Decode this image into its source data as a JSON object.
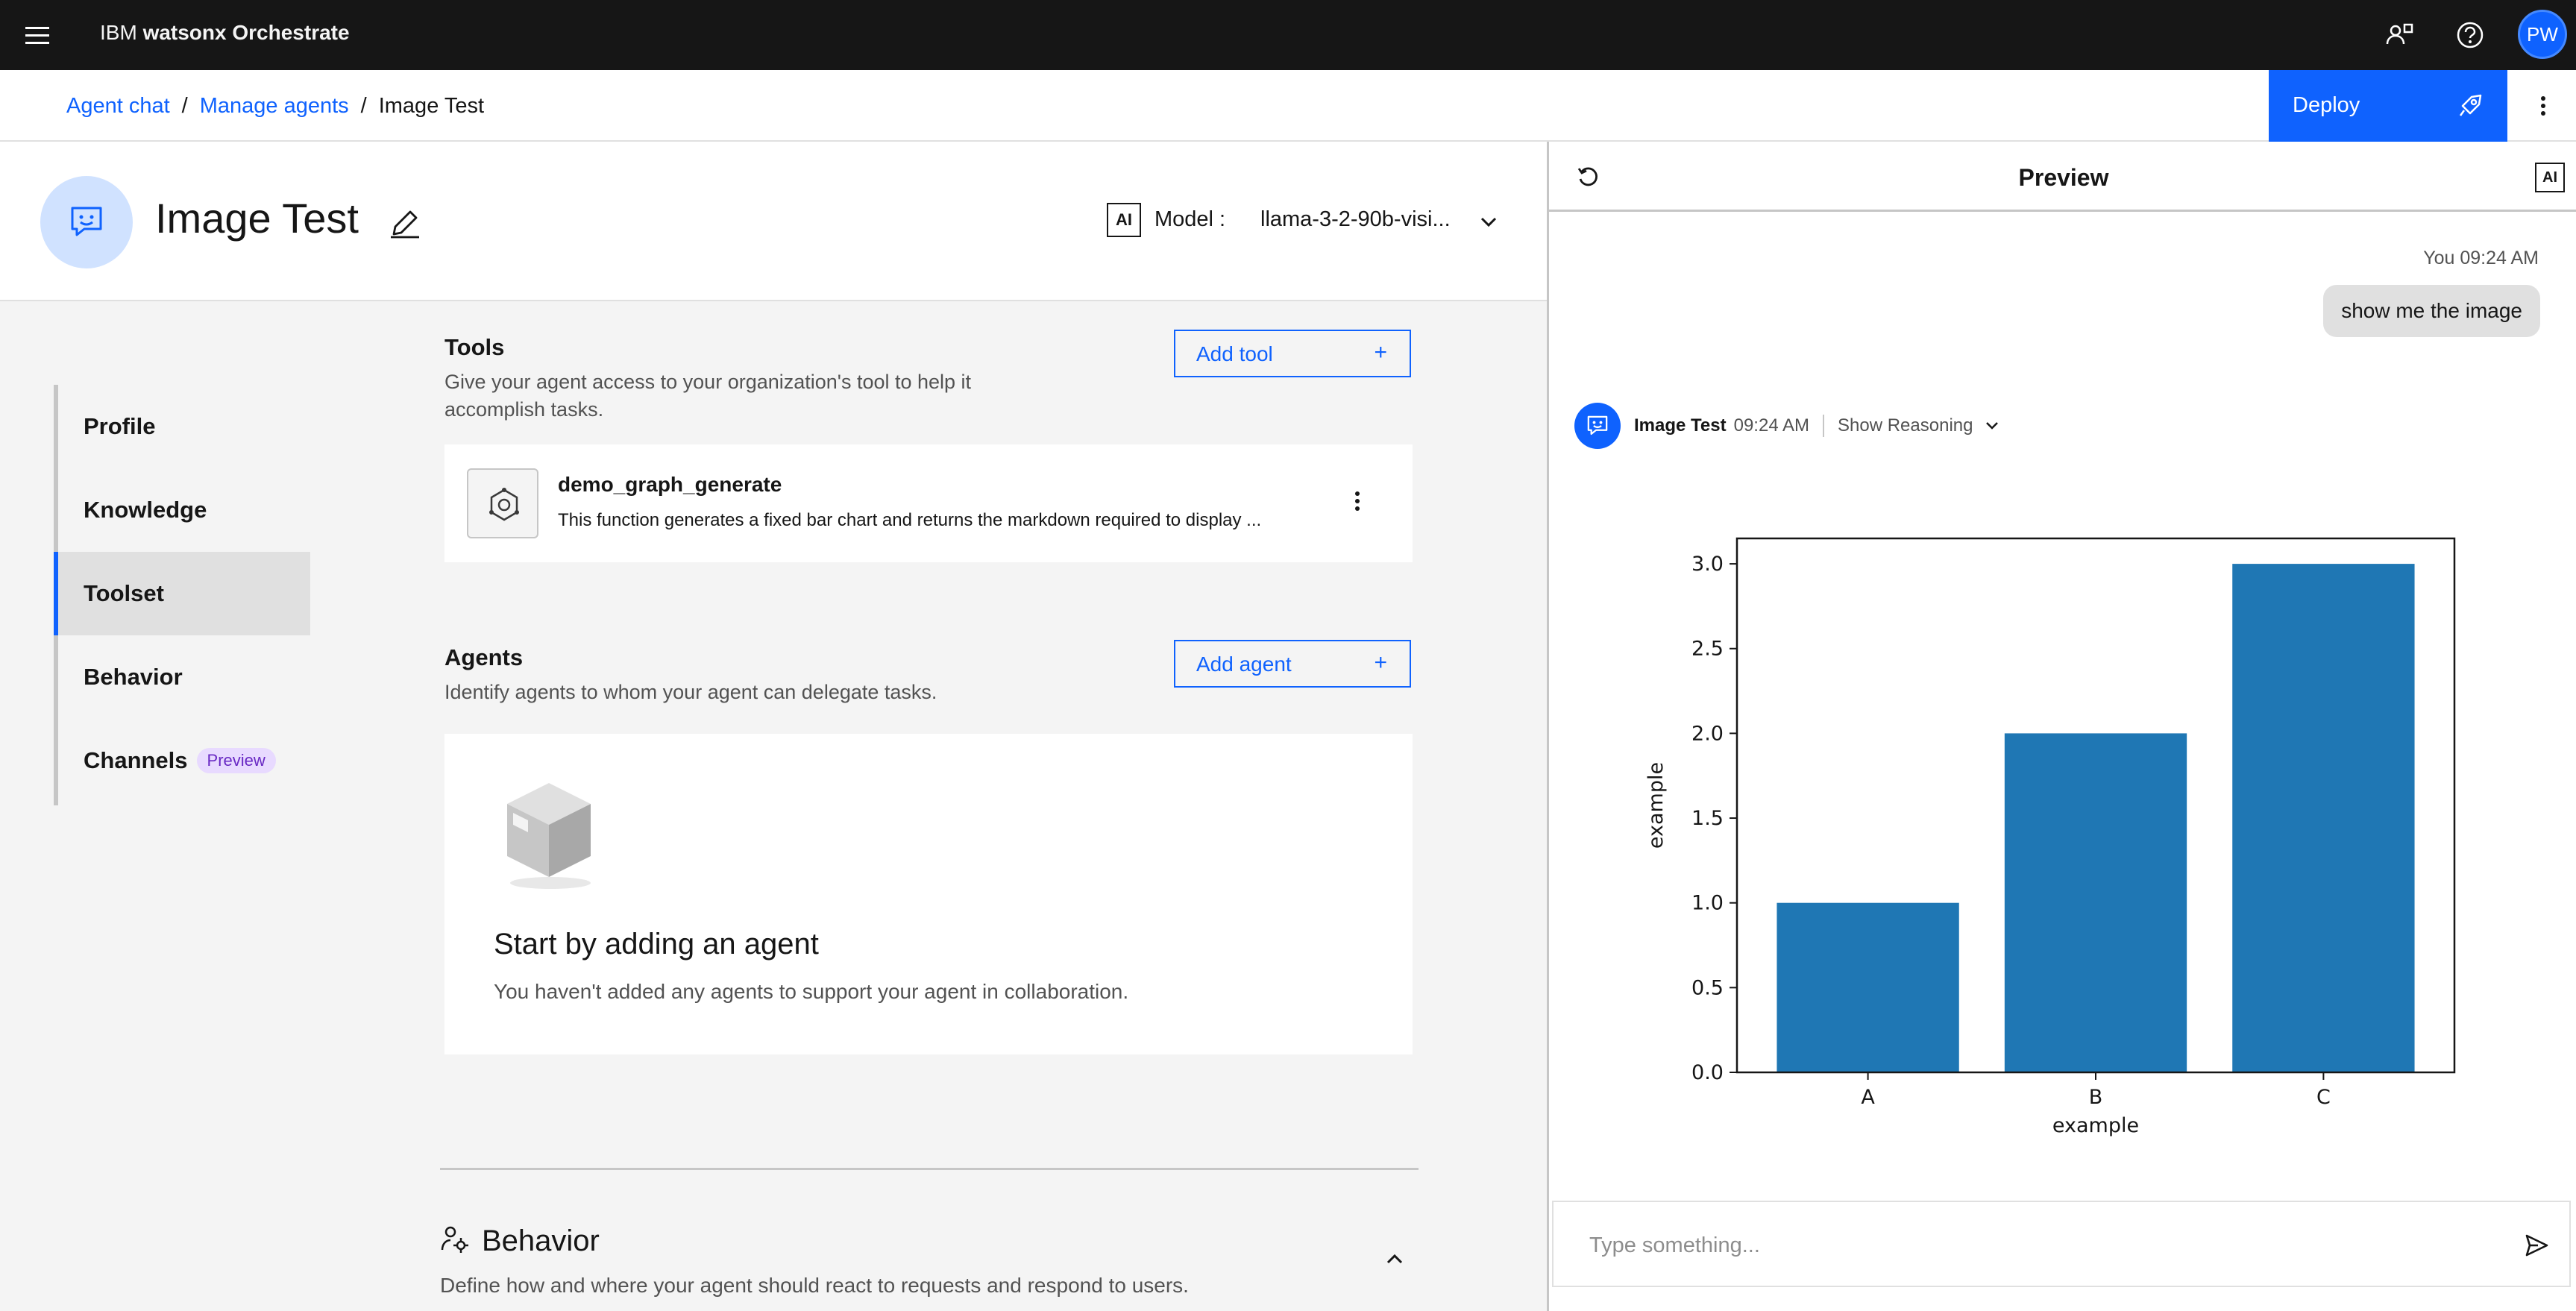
{
  "topbar": {
    "brand_prefix": "IBM",
    "brand_name": "watsonx Orchestrate",
    "avatar_initials": "PW",
    "icons": [
      "menu-icon",
      "user-switch-icon",
      "help-icon"
    ]
  },
  "breadcrumb": {
    "items": [
      "Agent chat",
      "Manage agents",
      "Image Test"
    ]
  },
  "deploy": {
    "label": "Deploy"
  },
  "agent": {
    "title": "Image Test",
    "ai_badge": "AI",
    "model_label": "Model :",
    "model_value": "llama-3-2-90b-visi..."
  },
  "sidenav": {
    "items": [
      "Profile",
      "Knowledge",
      "Toolset",
      "Behavior",
      "Channels"
    ],
    "active": "Toolset",
    "channels_tag": "Preview"
  },
  "tools": {
    "title": "Tools",
    "description": "Give your agent access to your organization's tool to help it accomplish tasks.",
    "add_label": "Add tool",
    "add_icon": "+",
    "items": [
      {
        "name": "demo_graph_generate",
        "description": "This function generates a fixed bar chart and returns the markdown required to display ..."
      }
    ]
  },
  "agents": {
    "title": "Agents",
    "description": "Identify agents to whom your agent can delegate tasks.",
    "add_label": "Add agent",
    "add_icon": "+",
    "empty_title": "Start by adding an agent",
    "empty_description": "You haven't added any agents to support your agent in collaboration."
  },
  "behavior": {
    "title": "Behavior",
    "description": "Define how and where your agent should react to requests and respond to users."
  },
  "preview": {
    "title": "Preview",
    "ai_badge": "AI",
    "user_meta": "You 09:24 AM",
    "user_message": "show me the image",
    "bot_name": "Image Test",
    "bot_time": "09:24 AM",
    "show_reasoning": "Show Reasoning",
    "input_placeholder": "Type something..."
  },
  "chart_data": {
    "type": "bar",
    "categories": [
      "A",
      "B",
      "C"
    ],
    "values": [
      1.0,
      2.0,
      3.0
    ],
    "xlabel": "example",
    "ylabel": "example",
    "ylim": [
      0,
      3.15
    ],
    "yticks": [
      "0.0",
      "0.5",
      "1.0",
      "1.5",
      "2.0",
      "2.5",
      "3.0"
    ],
    "ytick_values": [
      0,
      0.5,
      1.0,
      1.5,
      2.0,
      2.5,
      3.0
    ],
    "grid": false,
    "bar_color": "#1f77b4"
  }
}
